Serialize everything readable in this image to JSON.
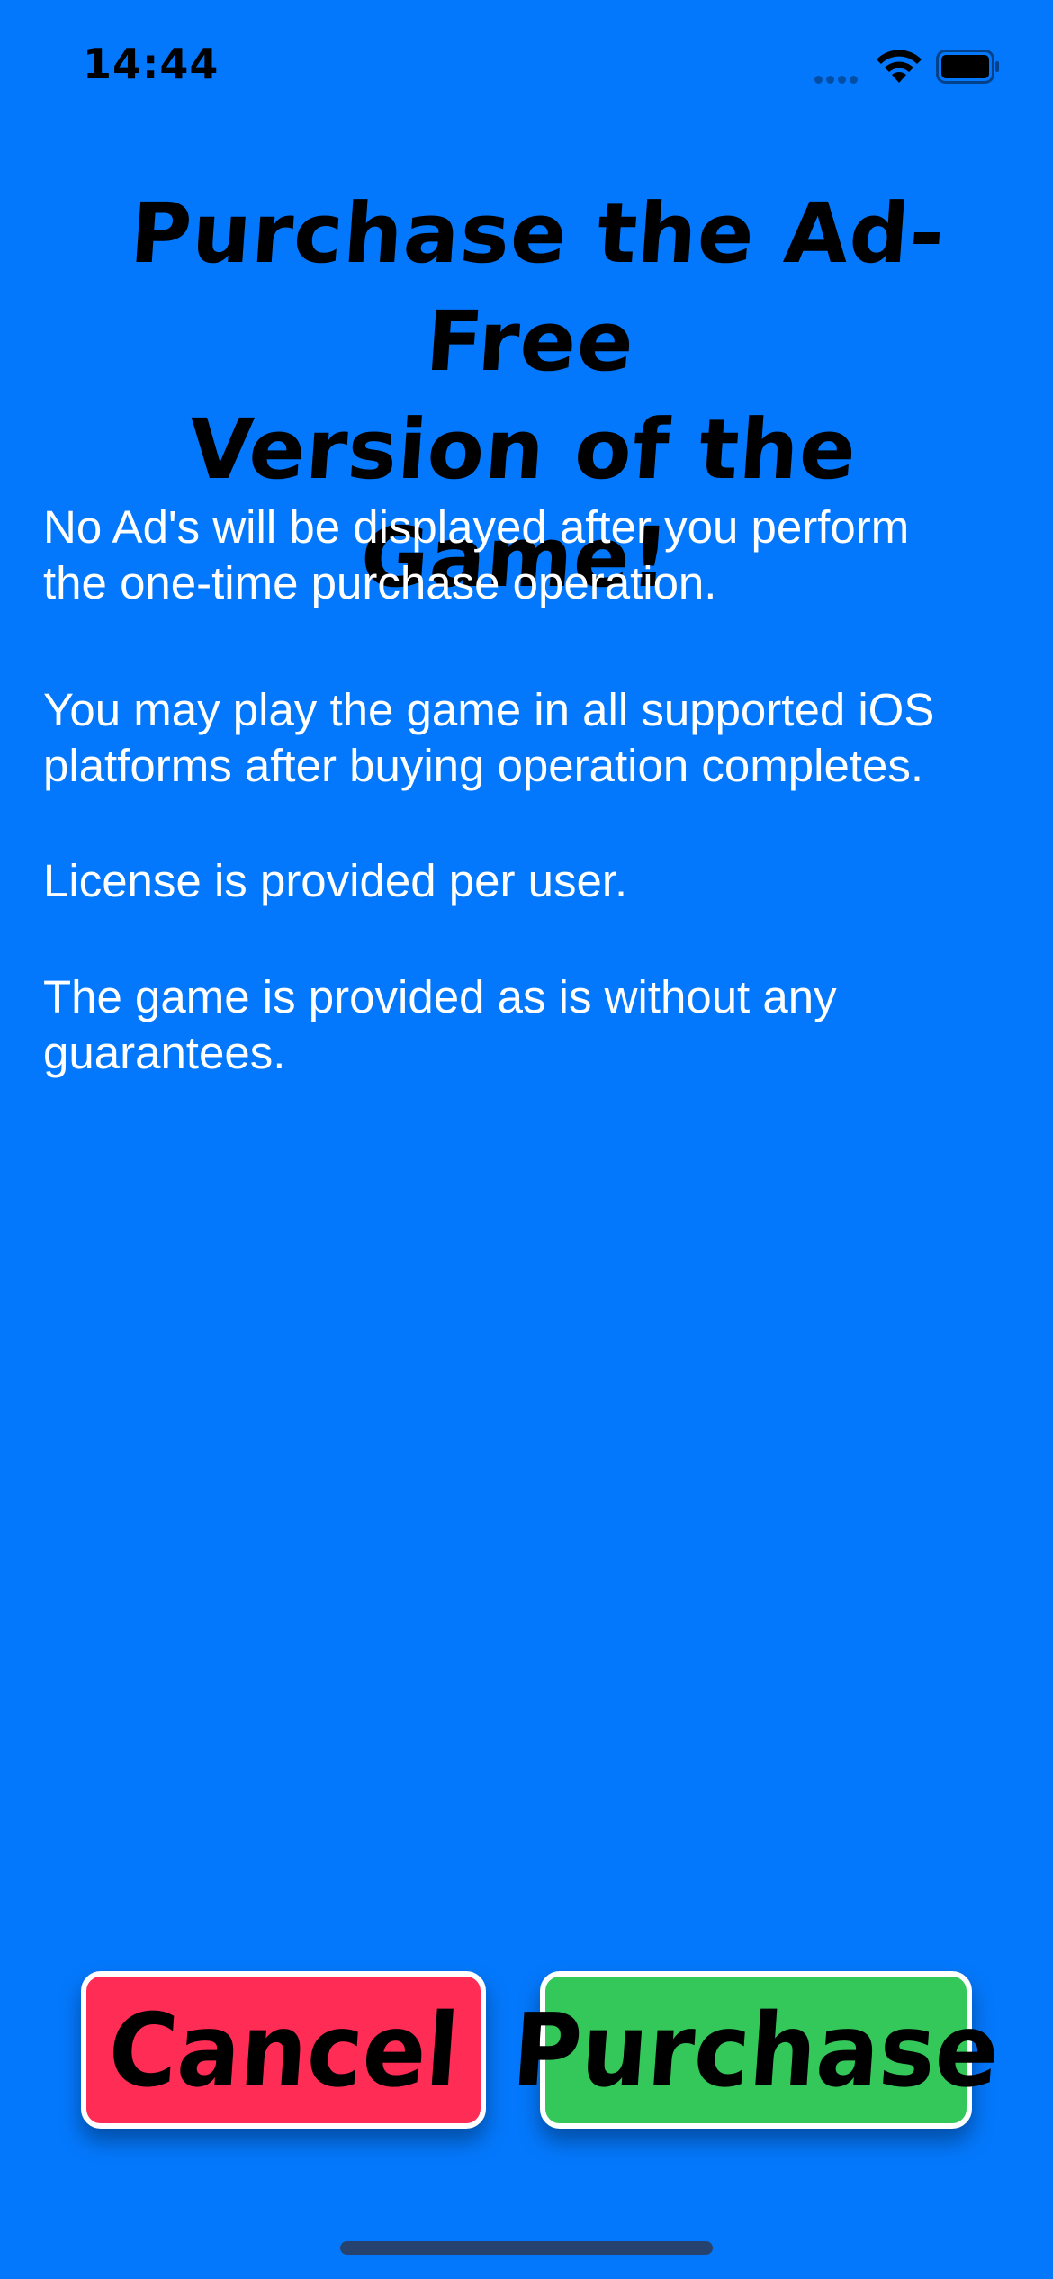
{
  "status_bar": {
    "time": "14:44",
    "icons": [
      "signal-icon",
      "wifi-icon",
      "battery-icon"
    ]
  },
  "title": {
    "line1": "Purchase the Ad-Free",
    "line2": "Version of the Game!"
  },
  "paragraphs": {
    "p1_line1": "No Ad's will be displayed after you perform",
    "p1_line2": "the one-time purchase operation.",
    "p2_line1": "You may play the game in all supported iOS",
    "p2_line2": "platforms after buying operation completes.",
    "p3": "License is provided per user.",
    "p4_line1": "The game is provided as is without any",
    "p4_line2": "guarantees."
  },
  "buttons": {
    "cancel_label": "Cancel",
    "purchase_label": "Purchase"
  },
  "colors": {
    "background": "#0478FC",
    "cancel": "#FF2D55",
    "purchase": "#34C759",
    "body_text": "#FFFFFF",
    "title_text": "#000000"
  }
}
